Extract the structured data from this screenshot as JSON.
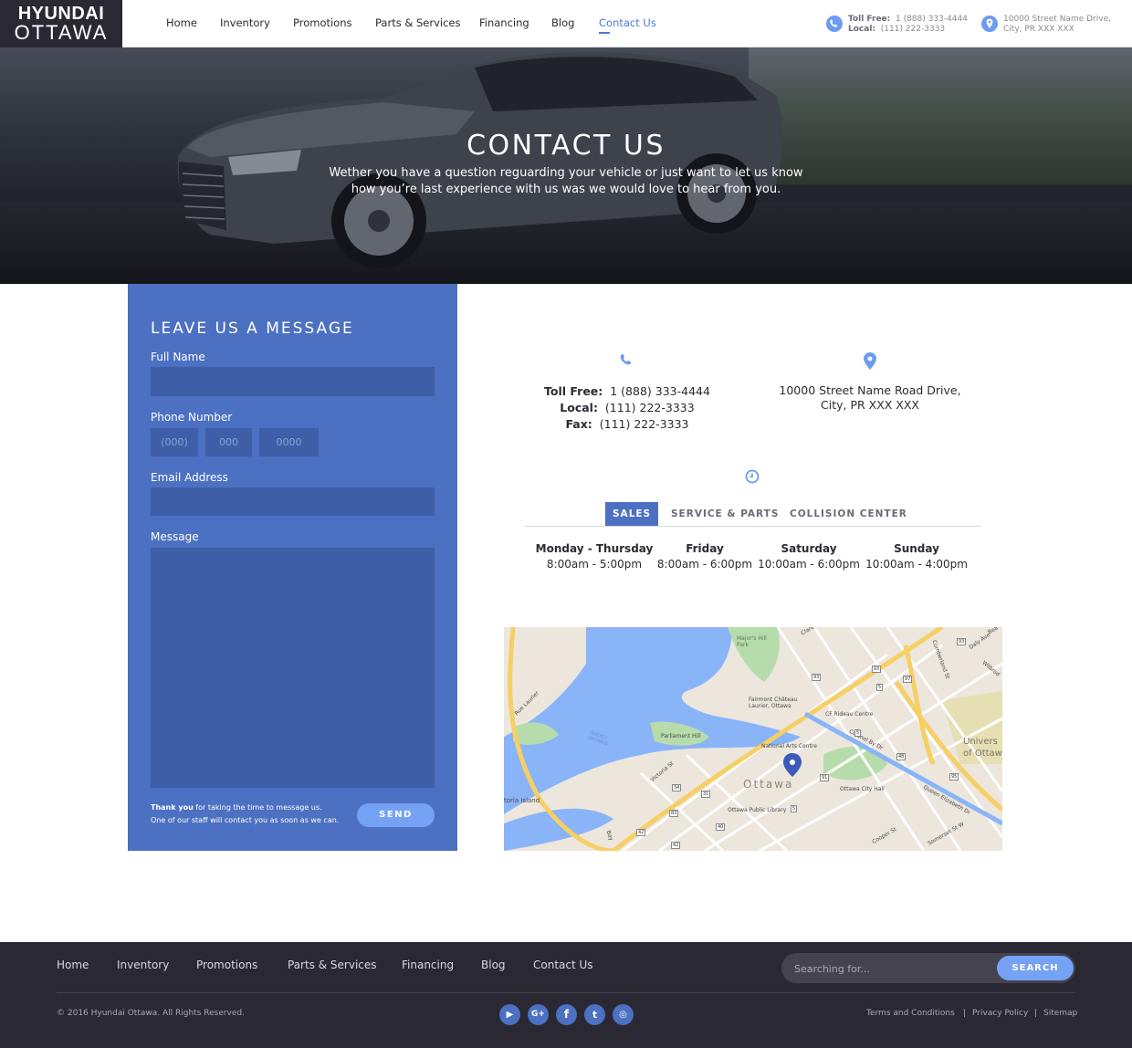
{
  "logo": {
    "line1": "HYUNDAI",
    "line2": "OTTAWA"
  },
  "nav": {
    "items": [
      "Home",
      "Inventory",
      "Promotions",
      "Parts & Services",
      "Financing",
      "Blog",
      "Contact Us"
    ],
    "active": "Contact Us"
  },
  "header_contact": {
    "toll_free_label": "Toll Free:",
    "toll_free": "1 (888) 333-4444",
    "local_label": "Local:",
    "local": "(111) 222-3333",
    "address_line1": "10000 Street Name Drive,",
    "address_line2": "City, PR  XXX XXX",
    "phone_icon": "phone-icon",
    "location_icon": "map-pin-icon"
  },
  "hero": {
    "title": "CONTACT US",
    "subtitle": "Wether you have a question reguarding your vehicle or just want to let us know how you’re last experience with us was we would love to hear from you."
  },
  "form": {
    "heading": "LEAVE US A MESSAGE",
    "full_name_label": "Full Name",
    "full_name_value": "",
    "phone_label": "Phone Number",
    "phone_area_placeholder": "(000)",
    "phone_prefix_placeholder": "000",
    "phone_line_placeholder": "0000",
    "email_label": "Email Address",
    "email_value": "",
    "message_label": "Message",
    "message_value": "",
    "thanks_bold": "Thank you",
    "thanks_rest": " for taking the time to message us.",
    "thanks_line2": "One of our staff will contact you as soon as we can.",
    "send_label": "SEND"
  },
  "contact_info": {
    "toll_free_label": "Toll Free:",
    "toll_free": "1 (888) 333-4444",
    "local_label": "Local:",
    "local": "(111) 222-3333",
    "fax_label": "Fax:",
    "fax": "(111) 222-3333",
    "address_line1": "10000 Street Name Road Drive,",
    "address_line2": "City, PR  XXX XXX",
    "phone_icon": "phone-icon",
    "location_icon": "map-pin-icon",
    "clock_icon": "clock-icon"
  },
  "hours": {
    "tabs": [
      "SALES",
      "SERVICE & PARTS",
      "COLLISION CENTER"
    ],
    "active_tab": "SALES",
    "schedule": [
      {
        "day": "Monday - Thursday",
        "time": "8:00am - 5:00pm"
      },
      {
        "day": "Friday",
        "time": "8:00am - 6:00pm"
      },
      {
        "day": "Saturday",
        "time": "10:00am - 6:00pm"
      },
      {
        "day": "Sunday",
        "time": "10:00am - 4:00pm"
      }
    ]
  },
  "map": {
    "city_label": "Ottawa",
    "labels": [
      "Major's Hill Park",
      "Fairmont Château Laurier, Ottawa",
      "CF Rideau Centre",
      "Parliament Hill",
      "National Arts Centre",
      "Ottawa City Hall",
      "Ottawa Public Library",
      "Colonel By Dr",
      "Queen Elizabeth Dr",
      "Victoria St",
      "Rue Laurier",
      "QUEBEC ONTARIO",
      "Cumberland St",
      "Daly Ave",
      "Wilbrod",
      "Clare",
      "Bea",
      "Cooper St",
      "Somerset St W",
      "toria Island",
      "Univers",
      "of Ottaw",
      "Bay"
    ],
    "route_numbers": [
      "93",
      "93",
      "5",
      "97",
      "5",
      "48",
      "95",
      "91",
      "34",
      "31",
      "5",
      "83",
      "42",
      "42",
      "40",
      "93"
    ],
    "colors": {
      "water": "#8ab4f8",
      "park": "#b7dcab",
      "land": "#ece6dd",
      "highway": "#f6cf65",
      "pin": "#3c5bbb"
    }
  },
  "footer": {
    "nav": [
      "Home",
      "Inventory",
      "Promotions",
      "Parts & Services",
      "Financing",
      "Blog",
      "Contact Us"
    ],
    "search_placeholder": "Searching for...",
    "search_button": "SEARCH",
    "copyright": "© 2016 Hyundai Ottawa. All Rights Reserved.",
    "social": [
      {
        "name": "youtube-icon",
        "glyph": "▶"
      },
      {
        "name": "google-plus-icon",
        "glyph": "G+"
      },
      {
        "name": "facebook-icon",
        "glyph": "f"
      },
      {
        "name": "twitter-icon",
        "glyph": "t"
      },
      {
        "name": "instagram-icon",
        "glyph": "◎"
      }
    ],
    "legal": [
      "Terms and Conditions",
      "Privacy Policy",
      "Sitemap"
    ],
    "legal_separator": "|"
  },
  "colors": {
    "accent": "#4c70c2",
    "accent_light": "#76a2f6",
    "dark": "#2a2833",
    "active_link": "#4a78d9"
  }
}
